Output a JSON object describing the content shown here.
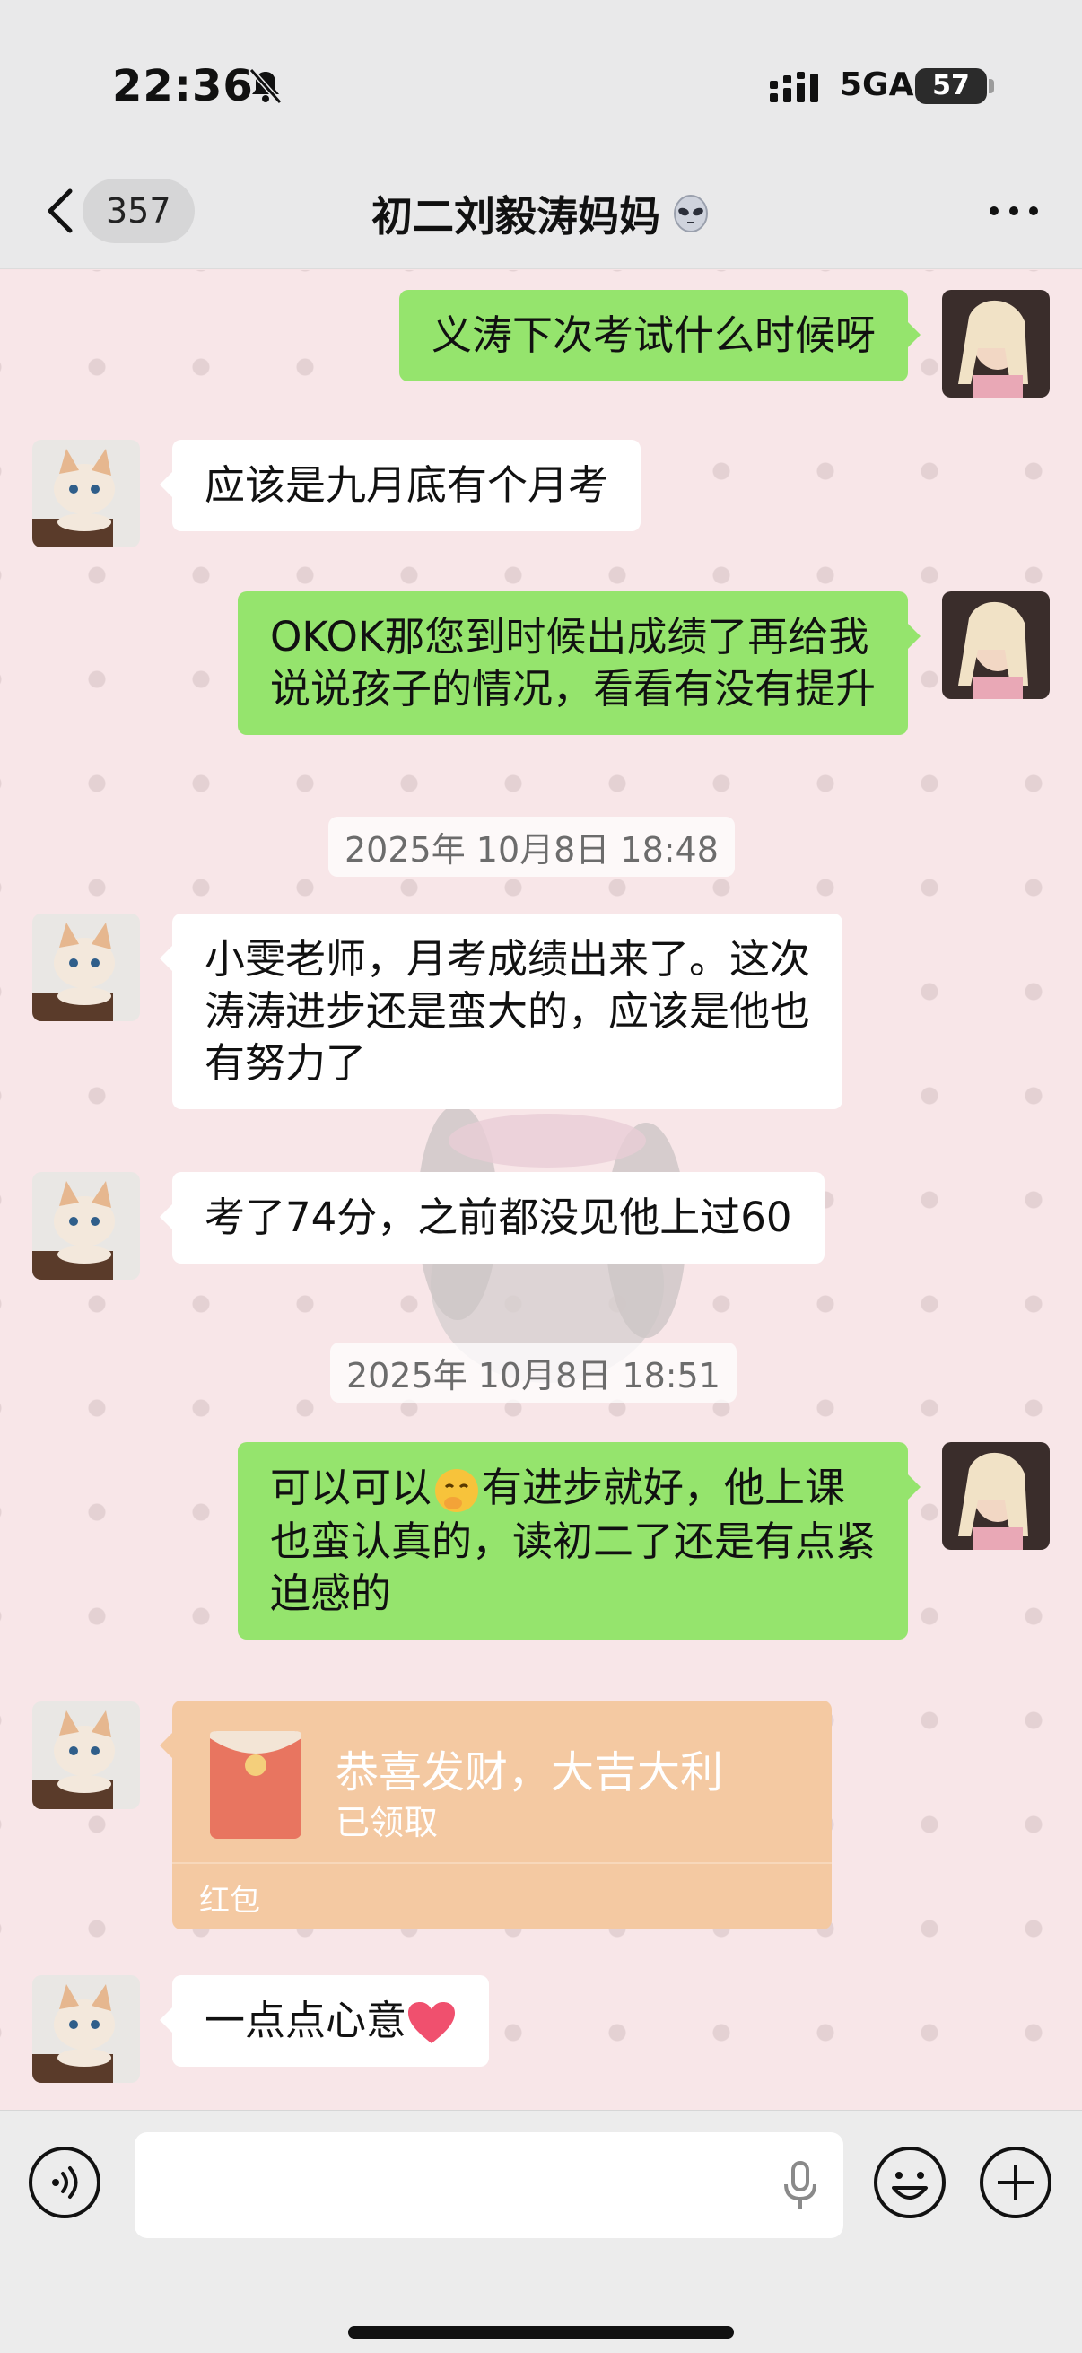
{
  "status_bar": {
    "time": "22:36",
    "network": "5GA",
    "battery": "57"
  },
  "header": {
    "back_count": "357",
    "title": "初二刘毅涛妈妈"
  },
  "messages": [
    {
      "side": "me",
      "text": "义涛下次考试什么时候呀"
    },
    {
      "side": "them",
      "text": "应该是九月底有个月考"
    },
    {
      "side": "me",
      "lines": [
        "OKOK那您到时候出成绩了再给我",
        "说说孩子的情况，看看有没有提升"
      ]
    },
    {
      "side": "them",
      "lines": [
        "小雯老师，月考成绩出来了。这次",
        "涛涛进步还是蛮大的，应该是他也",
        "有努力了"
      ]
    },
    {
      "side": "them",
      "text": "考了74分，之前都没见他上过60"
    },
    {
      "side": "me",
      "lines": [
        "可以可以",
        "有进步就好，他上课",
        "也蛮认真的，读初二了还是有点紧",
        "迫感的"
      ]
    },
    {
      "side": "them",
      "text": "一点点心意"
    }
  ],
  "timestamps": [
    "2025年 10月8日 18:48",
    "2025年 10月8日 18:51"
  ],
  "red_packet": {
    "title": "恭喜发财，大吉大利",
    "status": "已领取",
    "label": "红包"
  },
  "icons": [
    "bell-muted-icon",
    "signal-icon",
    "battery-icon",
    "back-icon",
    "alien-emoji-icon",
    "more-icon",
    "voice-icon",
    "mic-icon",
    "emoji-icon",
    "plus-icon",
    "red-packet-icon",
    "heart-emoji-icon",
    "shushing-emoji-icon"
  ],
  "colors": {
    "my_bubble": "#95e46d",
    "their_bubble": "#ffffff",
    "red_packet": "#f4c9a2",
    "background": "#f8e6e8"
  }
}
